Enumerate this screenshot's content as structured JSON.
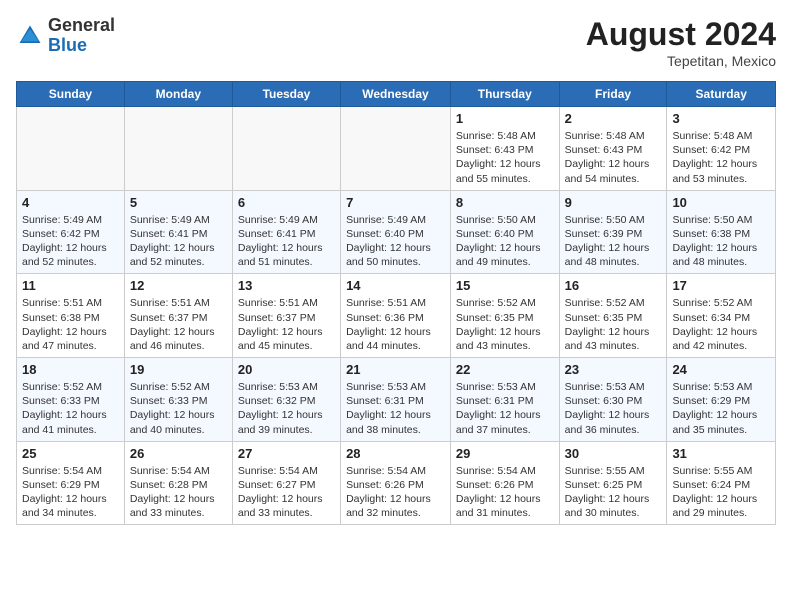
{
  "header": {
    "logo_general": "General",
    "logo_blue": "Blue",
    "month_year": "August 2024",
    "location": "Tepetitan, Mexico"
  },
  "days_of_week": [
    "Sunday",
    "Monday",
    "Tuesday",
    "Wednesday",
    "Thursday",
    "Friday",
    "Saturday"
  ],
  "weeks": [
    [
      {
        "day": "",
        "info": ""
      },
      {
        "day": "",
        "info": ""
      },
      {
        "day": "",
        "info": ""
      },
      {
        "day": "",
        "info": ""
      },
      {
        "day": "1",
        "info": "Sunrise: 5:48 AM\nSunset: 6:43 PM\nDaylight: 12 hours\nand 55 minutes."
      },
      {
        "day": "2",
        "info": "Sunrise: 5:48 AM\nSunset: 6:43 PM\nDaylight: 12 hours\nand 54 minutes."
      },
      {
        "day": "3",
        "info": "Sunrise: 5:48 AM\nSunset: 6:42 PM\nDaylight: 12 hours\nand 53 minutes."
      }
    ],
    [
      {
        "day": "4",
        "info": "Sunrise: 5:49 AM\nSunset: 6:42 PM\nDaylight: 12 hours\nand 52 minutes."
      },
      {
        "day": "5",
        "info": "Sunrise: 5:49 AM\nSunset: 6:41 PM\nDaylight: 12 hours\nand 52 minutes."
      },
      {
        "day": "6",
        "info": "Sunrise: 5:49 AM\nSunset: 6:41 PM\nDaylight: 12 hours\nand 51 minutes."
      },
      {
        "day": "7",
        "info": "Sunrise: 5:49 AM\nSunset: 6:40 PM\nDaylight: 12 hours\nand 50 minutes."
      },
      {
        "day": "8",
        "info": "Sunrise: 5:50 AM\nSunset: 6:40 PM\nDaylight: 12 hours\nand 49 minutes."
      },
      {
        "day": "9",
        "info": "Sunrise: 5:50 AM\nSunset: 6:39 PM\nDaylight: 12 hours\nand 48 minutes."
      },
      {
        "day": "10",
        "info": "Sunrise: 5:50 AM\nSunset: 6:38 PM\nDaylight: 12 hours\nand 48 minutes."
      }
    ],
    [
      {
        "day": "11",
        "info": "Sunrise: 5:51 AM\nSunset: 6:38 PM\nDaylight: 12 hours\nand 47 minutes."
      },
      {
        "day": "12",
        "info": "Sunrise: 5:51 AM\nSunset: 6:37 PM\nDaylight: 12 hours\nand 46 minutes."
      },
      {
        "day": "13",
        "info": "Sunrise: 5:51 AM\nSunset: 6:37 PM\nDaylight: 12 hours\nand 45 minutes."
      },
      {
        "day": "14",
        "info": "Sunrise: 5:51 AM\nSunset: 6:36 PM\nDaylight: 12 hours\nand 44 minutes."
      },
      {
        "day": "15",
        "info": "Sunrise: 5:52 AM\nSunset: 6:35 PM\nDaylight: 12 hours\nand 43 minutes."
      },
      {
        "day": "16",
        "info": "Sunrise: 5:52 AM\nSunset: 6:35 PM\nDaylight: 12 hours\nand 43 minutes."
      },
      {
        "day": "17",
        "info": "Sunrise: 5:52 AM\nSunset: 6:34 PM\nDaylight: 12 hours\nand 42 minutes."
      }
    ],
    [
      {
        "day": "18",
        "info": "Sunrise: 5:52 AM\nSunset: 6:33 PM\nDaylight: 12 hours\nand 41 minutes."
      },
      {
        "day": "19",
        "info": "Sunrise: 5:52 AM\nSunset: 6:33 PM\nDaylight: 12 hours\nand 40 minutes."
      },
      {
        "day": "20",
        "info": "Sunrise: 5:53 AM\nSunset: 6:32 PM\nDaylight: 12 hours\nand 39 minutes."
      },
      {
        "day": "21",
        "info": "Sunrise: 5:53 AM\nSunset: 6:31 PM\nDaylight: 12 hours\nand 38 minutes."
      },
      {
        "day": "22",
        "info": "Sunrise: 5:53 AM\nSunset: 6:31 PM\nDaylight: 12 hours\nand 37 minutes."
      },
      {
        "day": "23",
        "info": "Sunrise: 5:53 AM\nSunset: 6:30 PM\nDaylight: 12 hours\nand 36 minutes."
      },
      {
        "day": "24",
        "info": "Sunrise: 5:53 AM\nSunset: 6:29 PM\nDaylight: 12 hours\nand 35 minutes."
      }
    ],
    [
      {
        "day": "25",
        "info": "Sunrise: 5:54 AM\nSunset: 6:29 PM\nDaylight: 12 hours\nand 34 minutes."
      },
      {
        "day": "26",
        "info": "Sunrise: 5:54 AM\nSunset: 6:28 PM\nDaylight: 12 hours\nand 33 minutes."
      },
      {
        "day": "27",
        "info": "Sunrise: 5:54 AM\nSunset: 6:27 PM\nDaylight: 12 hours\nand 33 minutes."
      },
      {
        "day": "28",
        "info": "Sunrise: 5:54 AM\nSunset: 6:26 PM\nDaylight: 12 hours\nand 32 minutes."
      },
      {
        "day": "29",
        "info": "Sunrise: 5:54 AM\nSunset: 6:26 PM\nDaylight: 12 hours\nand 31 minutes."
      },
      {
        "day": "30",
        "info": "Sunrise: 5:55 AM\nSunset: 6:25 PM\nDaylight: 12 hours\nand 30 minutes."
      },
      {
        "day": "31",
        "info": "Sunrise: 5:55 AM\nSunset: 6:24 PM\nDaylight: 12 hours\nand 29 minutes."
      }
    ]
  ]
}
